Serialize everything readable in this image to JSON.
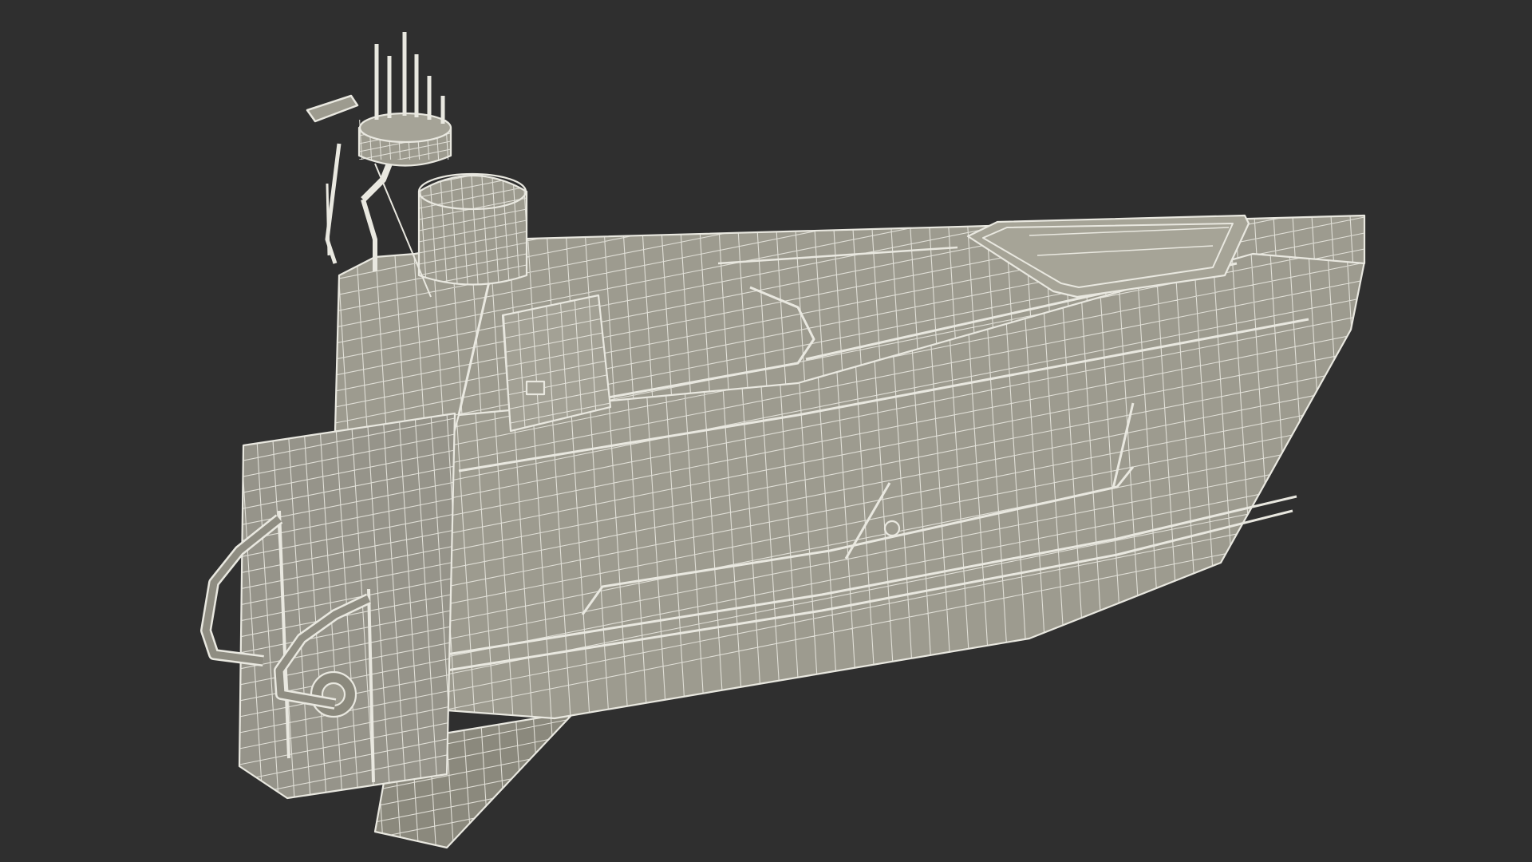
{
  "scene": {
    "background": "#2f2f2f",
    "model_fill": "#9d9b8f",
    "model_shade": "#8b897d",
    "wire": "#e9e8e0",
    "subject": "boat-wireframe-render"
  }
}
